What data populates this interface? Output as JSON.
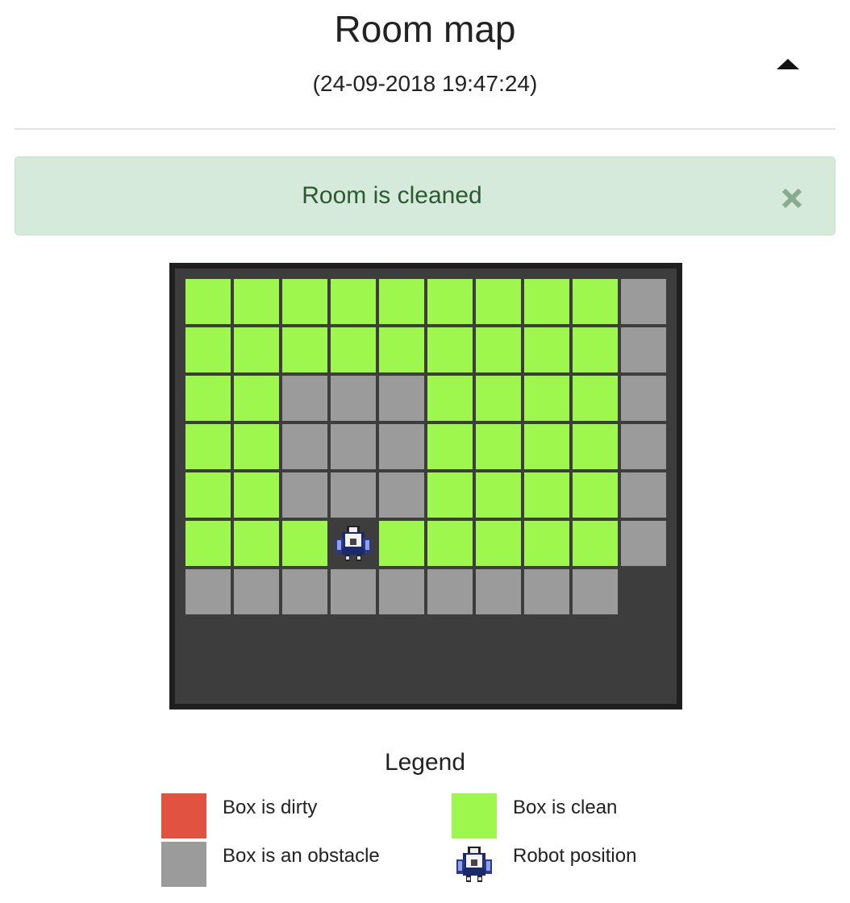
{
  "header": {
    "title": "Room map",
    "timestamp": "(24-09-2018 19:47:24)",
    "collapse_icon": "caret-up-icon"
  },
  "alert": {
    "message": "Room is cleaned",
    "close_icon": "close-icon",
    "background": "#d6eadb",
    "text_color": "#2b5a32"
  },
  "map": {
    "rows": 7,
    "cols": 10,
    "robot": {
      "row": 5,
      "col": 3
    },
    "grid": [
      [
        "clean",
        "clean",
        "clean",
        "clean",
        "clean",
        "clean",
        "clean",
        "clean",
        "clean",
        "obstacle"
      ],
      [
        "clean",
        "clean",
        "clean",
        "clean",
        "clean",
        "clean",
        "clean",
        "clean",
        "clean",
        "obstacle"
      ],
      [
        "clean",
        "clean",
        "obstacle",
        "obstacle",
        "obstacle",
        "clean",
        "clean",
        "clean",
        "clean",
        "obstacle"
      ],
      [
        "clean",
        "clean",
        "obstacle",
        "obstacle",
        "obstacle",
        "clean",
        "clean",
        "clean",
        "clean",
        "obstacle"
      ],
      [
        "clean",
        "clean",
        "obstacle",
        "obstacle",
        "obstacle",
        "clean",
        "clean",
        "clean",
        "clean",
        "obstacle"
      ],
      [
        "clean",
        "clean",
        "clean",
        "robot",
        "clean",
        "clean",
        "clean",
        "clean",
        "clean",
        "obstacle"
      ],
      [
        "obstacle",
        "obstacle",
        "obstacle",
        "obstacle",
        "obstacle",
        "obstacle",
        "obstacle",
        "obstacle",
        "obstacle",
        "empty"
      ]
    ],
    "colors": {
      "clean": "#9ef74c",
      "obstacle": "#9b9b9b",
      "dirty": "#e15241",
      "background": "#3d3d3d",
      "frame": "#1f1f1f"
    }
  },
  "legend": {
    "title": "Legend",
    "items": [
      {
        "label": "Box is dirty",
        "swatch": "dirty"
      },
      {
        "label": "Box is clean",
        "swatch": "clean"
      },
      {
        "label": "Box is an obstacle",
        "swatch": "obstacle"
      },
      {
        "label": "Robot position",
        "swatch": "robot"
      }
    ]
  }
}
